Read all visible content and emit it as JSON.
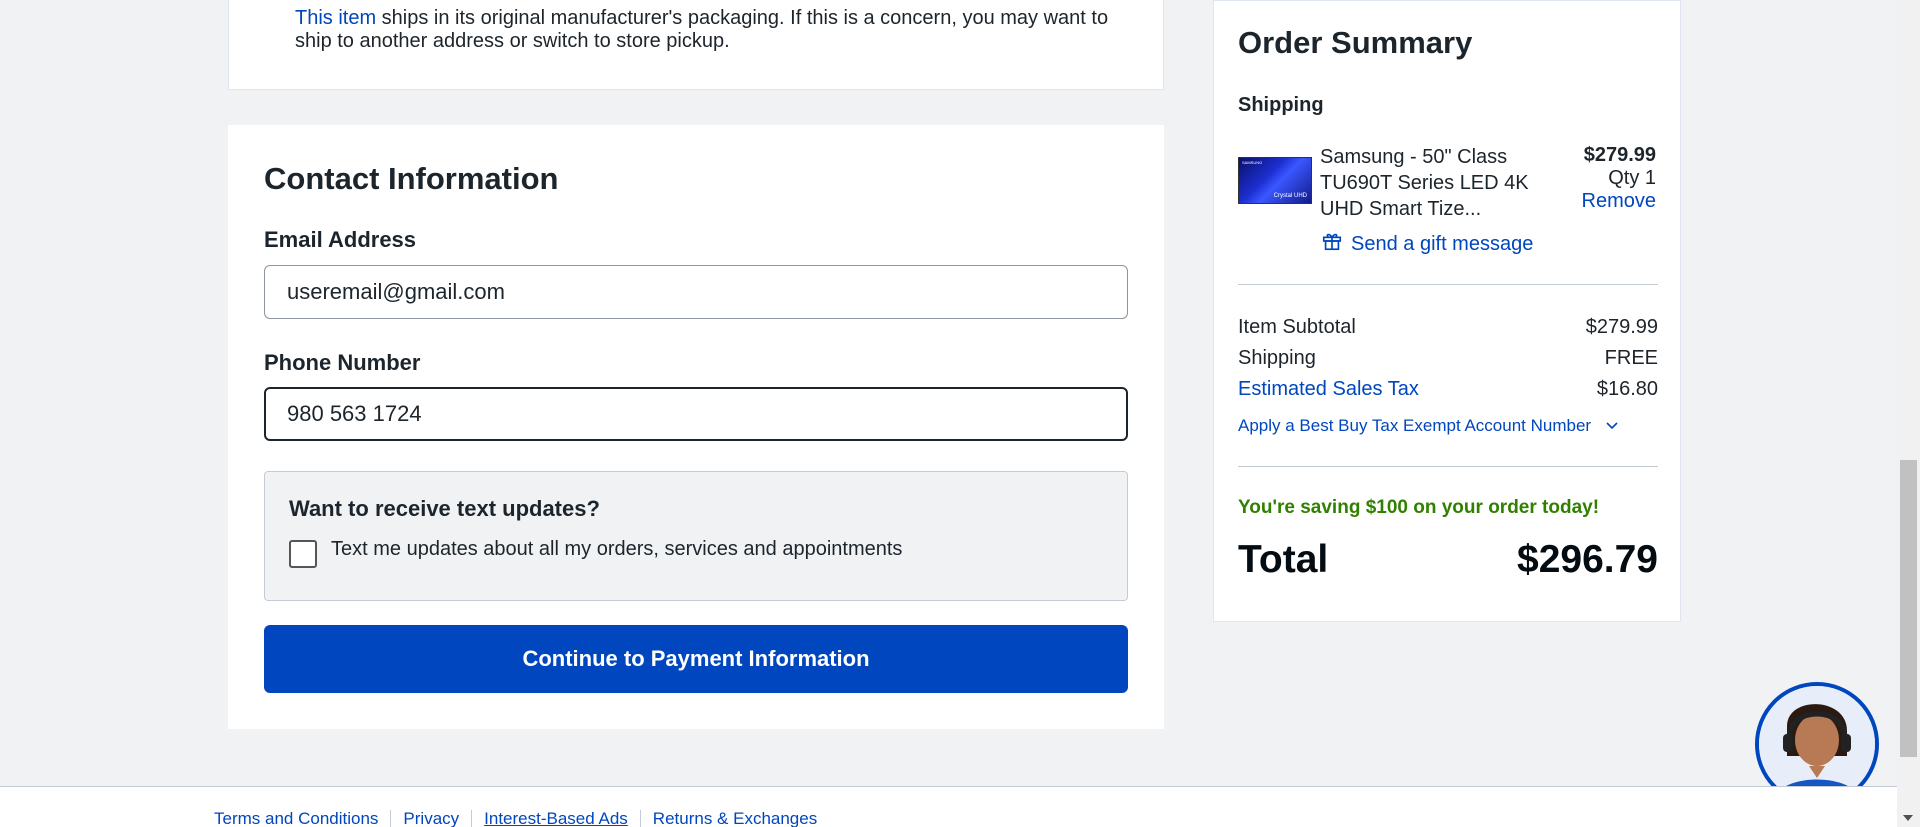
{
  "notice": {
    "link_text": "This item",
    "text": " ships in its original manufacturer's packaging. If this is a concern, you may want to ship to another address or switch to store pickup."
  },
  "contact": {
    "title": "Contact Information",
    "email_label": "Email Address",
    "email_value": "useremail@gmail.com",
    "phone_label": "Phone Number",
    "phone_value": "980 563 1724",
    "text_updates_title": "Want to receive text updates?",
    "text_updates_checkbox_label": "Text me updates about all my orders, services and appointments",
    "text_updates_checked": false,
    "continue_label": "Continue to Payment Information"
  },
  "summary": {
    "title": "Order Summary",
    "section": "Shipping",
    "product": {
      "thumb_brand": "SAMSUNG",
      "thumb_badge": "Crystal UHD",
      "name": "Samsung - 50\" Class TU690T Series LED 4K UHD Smart Tize...",
      "price": "$279.99",
      "qty": "Qty 1",
      "remove_label": "Remove",
      "gift_label": "Send a gift message"
    },
    "lines": [
      {
        "label": "Item Subtotal",
        "value": "$279.99",
        "link": false
      },
      {
        "label": "Shipping",
        "value": "FREE",
        "link": false
      },
      {
        "label": "Estimated Sales Tax",
        "value": "$16.80",
        "link": true
      }
    ],
    "exempt_label": "Apply a Best Buy Tax Exempt Account Number",
    "savings": "You're saving $100 on your order today!",
    "total_label": "Total",
    "total_value": "$296.79"
  },
  "footer": {
    "links": [
      "Terms and Conditions",
      "Privacy",
      "Interest-Based Ads",
      "Returns & Exchanges"
    ]
  },
  "colors": {
    "accent": "#0046be",
    "savings": "#318000",
    "page_bg": "#f0f2f4"
  },
  "icons": [
    "gift-icon",
    "chevron-down-icon",
    "chat-agent-avatar"
  ]
}
